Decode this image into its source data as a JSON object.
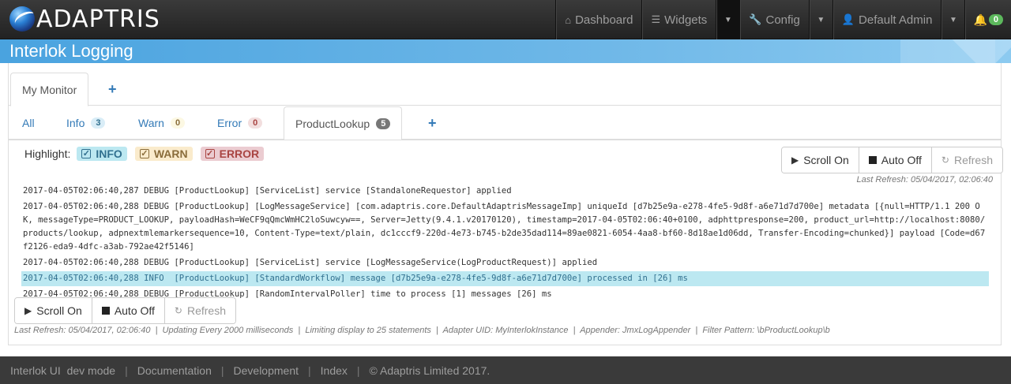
{
  "navbar": {
    "logo_text": "ADAPTRIS",
    "items": [
      {
        "label": "Dashboard"
      },
      {
        "label": "Widgets"
      },
      {
        "label": "Config"
      },
      {
        "label": "Default Admin"
      }
    ],
    "notifications_count": "0"
  },
  "banner": {
    "title": "Interlok Logging"
  },
  "monitor_tabs": {
    "active_label": "My Monitor",
    "add_label": "+"
  },
  "level_tabs": [
    {
      "label": "All"
    },
    {
      "label": "Info",
      "count": "3"
    },
    {
      "label": "Warn",
      "count": "0"
    },
    {
      "label": "Error",
      "count": "0"
    },
    {
      "label": "ProductLookup",
      "count": "5"
    }
  ],
  "highlight": {
    "label": "Highlight:",
    "info": "INFO",
    "warn": "WARN",
    "error": "ERROR"
  },
  "controls": {
    "scroll": "Scroll On",
    "auto": "Auto Off",
    "refresh": "Refresh"
  },
  "last_refresh_top": "Last Refresh: 05/04/2017, 02:06:40",
  "log_lines": [
    "2017-04-05T02:06:40,287 DEBUG [ProductLookup] [ServiceList] service [StandaloneRequestor] applied",
    "2017-04-05T02:06:40,288 DEBUG [ProductLookup] [LogMessageService] [com.adaptris.core.DefaultAdaptrisMessageImp] uniqueId [d7b25e9a-e278-4fe5-9d8f-a6e71d7d700e] metadata [{null=HTTP/1.1 200 OK, messageType=PRODUCT_LOOKUP, payloadHash=WeCF9qQmcWmHC2loSuwcyw==, Server=Jetty(9.4.1.v20170120), timestamp=2017-04-05T02:06:40+0100, adphttpresponse=200, product_url=http://localhost:8080/products/lookup, adpnextmlemarkersequence=10, Content-Type=text/plain, dc1cccf9-220d-4e73-b745-b2de35dad114=89ae0821-6054-4aa8-bf60-8d18ae1d06dd, Transfer-Encoding=chunked}] payload [Code=d67f2126-eda9-4dfc-a3ab-792ae42f5146]",
    "2017-04-05T02:06:40,288 DEBUG [ProductLookup] [ServiceList] service [LogMessageService(LogProductRequest)] applied",
    "2017-04-05T02:06:40,288 INFO  [ProductLookup] [StandardWorkflow] message [d7b25e9a-e278-4fe5-9d8f-a6e71d7d700e] processed in [26] ms",
    "2017-04-05T02:06:40,288 DEBUG [ProductLookup] [RandomIntervalPoller] time to process [1] messages [26] ms"
  ],
  "status_bar": "Last Refresh: 05/04/2017, 02:06:40  |  Updating Every 2000 milliseconds  |  Limiting display to 25 statements  |  Adapter UID: MyInterlokInstance  |  Appender: JmxLogAppender  |  Filter Pattern: \\bProductLookup\\b",
  "footer": {
    "product": "Interlok UI  dev mode",
    "links": [
      "Documentation",
      "Development",
      "Index"
    ],
    "copyright": "© Adaptris Limited 2017."
  }
}
